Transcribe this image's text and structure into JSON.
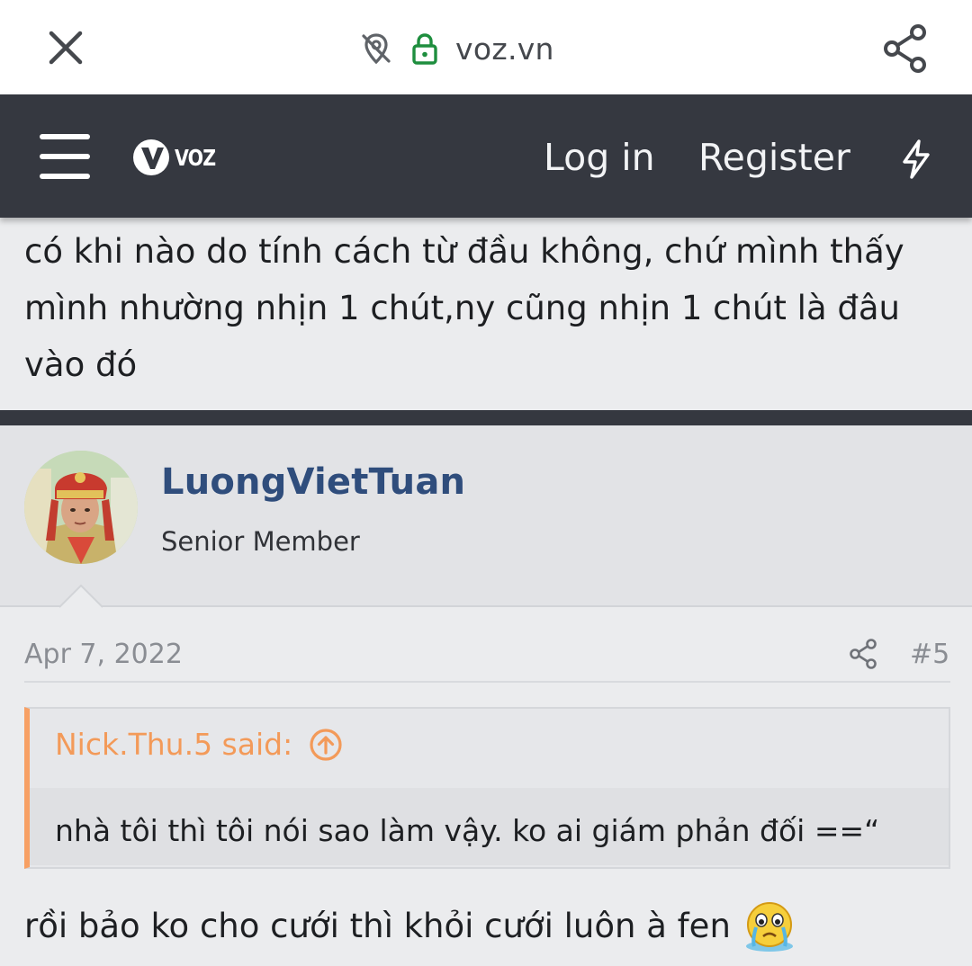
{
  "browser": {
    "url": "voz.vn",
    "close_icon": "close-icon",
    "tracking_icon": "location-off-icon",
    "lock_icon": "lock-icon",
    "share_icon": "share-icon"
  },
  "header": {
    "logo_text": "VOZ",
    "login_label": "Log in",
    "register_label": "Register",
    "menu_icon": "hamburger-menu-icon",
    "whats_new_icon": "lightning-bolt-icon",
    "background_color": "#353840"
  },
  "previous_post": {
    "text": "có khi nào do tính cách từ đầu không, chứ mình thấy mình nhường nhịn 1 chút,ny cũng nhịn 1 chút là đâu vào đó"
  },
  "post": {
    "username": "LuongVietTuan",
    "user_title": "Senior Member",
    "date": "Apr 7, 2022",
    "number": "#5",
    "quote": {
      "author": "Nick.Thu.5 said:",
      "content": "nhà tôi thì tôi nói sao làm vậy. ko ai giám phản đối ==“",
      "accent_color": "#f7a064"
    },
    "reply": "rồi bảo ko cho cưới thì khỏi cưới luôn à fen",
    "emoji": "crying-emoji"
  },
  "colors": {
    "username": "#2f4d7c",
    "quote_author": "#f39a59",
    "page_background": "#ebecee"
  }
}
